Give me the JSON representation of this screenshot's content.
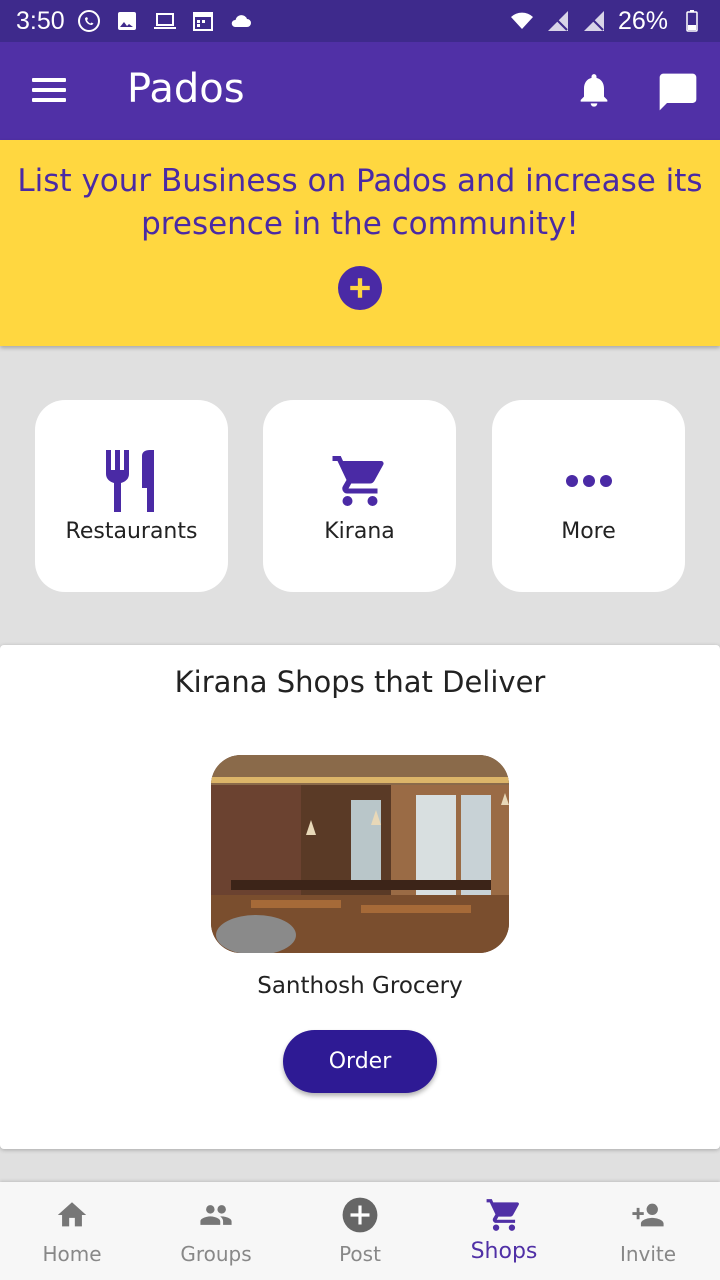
{
  "status_bar": {
    "time": "3:50",
    "battery": "26%"
  },
  "app_bar": {
    "title": "Pados"
  },
  "banner": {
    "text": "List your Business on Pados and increase its presence in the community!"
  },
  "categories": [
    {
      "label": "Restaurants",
      "icon": "fork-knife-icon"
    },
    {
      "label": "Kirana",
      "icon": "shopping-cart-icon"
    },
    {
      "label": "More",
      "icon": "more-dots-icon"
    }
  ],
  "card": {
    "title": "Kirana Shops that Deliver",
    "shop_name": "Santhosh Grocery",
    "order_label": "Order"
  },
  "bottom_nav": [
    {
      "label": "Home",
      "icon": "home-icon",
      "active": false
    },
    {
      "label": "Groups",
      "icon": "groups-icon",
      "active": false
    },
    {
      "label": "Post",
      "icon": "add-circle-icon",
      "active": false
    },
    {
      "label": "Shops",
      "icon": "shopping-cart-icon",
      "active": true
    },
    {
      "label": "Invite",
      "icon": "add-person-icon",
      "active": false
    }
  ],
  "colors": {
    "status_bar": "#3e2a8c",
    "primary": "#5030a6",
    "banner": "#ffd740",
    "order_button": "#2e1a94",
    "nav_inactive": "#888888"
  }
}
